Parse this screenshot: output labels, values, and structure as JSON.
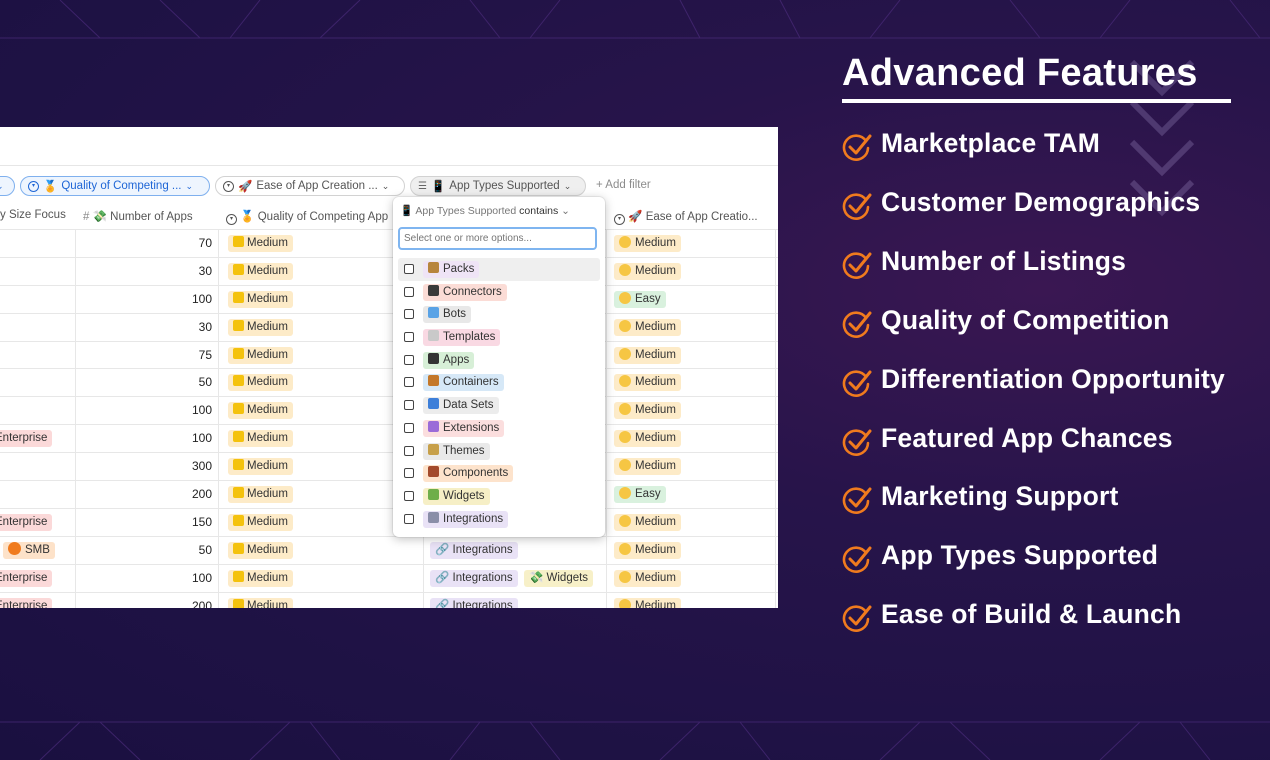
{
  "filter_bar": {
    "chip_quality": "Quality of Competing ...",
    "chip_ease": "Ease of App Creation ...",
    "chip_app_types": "App Types Supported",
    "add_filter": "Add filter"
  },
  "columns": {
    "size_focus": "y Size Focus",
    "number_of_apps": "Number of Apps",
    "quality": "Quality of Competing App",
    "ease": "Ease of App Creatio..."
  },
  "rows": [
    {
      "size": "",
      "apps": "70",
      "quality": "Medium",
      "types": [],
      "ease": "Medium"
    },
    {
      "size": "",
      "apps": "30",
      "quality": "Medium",
      "types": [],
      "ease": "Medium"
    },
    {
      "size": "",
      "apps": "100",
      "quality": "Medium",
      "types": [],
      "ease": "Easy"
    },
    {
      "size": "",
      "apps": "30",
      "quality": "Medium",
      "types": [],
      "ease": "Medium"
    },
    {
      "size": "",
      "apps": "75",
      "quality": "Medium",
      "types": [],
      "ease": "Medium"
    },
    {
      "size": "",
      "apps": "50",
      "quality": "Medium",
      "types": [],
      "ease": "Medium"
    },
    {
      "size": "",
      "apps": "100",
      "quality": "Medium",
      "types": [],
      "ease": "Medium"
    },
    {
      "size": "Enterprise",
      "apps": "100",
      "quality": "Medium",
      "types": [],
      "ease": "Medium"
    },
    {
      "size": "",
      "apps": "300",
      "quality": "Medium",
      "types": [],
      "ease": "Medium"
    },
    {
      "size": "",
      "apps": "200",
      "quality": "Medium",
      "types": [],
      "ease": "Easy"
    },
    {
      "size": "Enterprise",
      "apps": "150",
      "quality": "Medium",
      "types": [],
      "ease": "Medium"
    },
    {
      "size": "SMB",
      "apps": "50",
      "quality": "Medium",
      "types": [
        "Integrations"
      ],
      "ease": "Medium"
    },
    {
      "size": "Enterprise",
      "apps": "100",
      "quality": "Medium",
      "types": [
        "Integrations",
        "Widgets"
      ],
      "ease": "Medium"
    },
    {
      "size": "Enterprise",
      "apps": "200",
      "quality": "Medium",
      "types": [
        "Integrations"
      ],
      "ease": "Medium"
    }
  ],
  "dropdown": {
    "field": "App Types Supported",
    "operator": "contains",
    "placeholder": "Select one or more options...",
    "options": [
      {
        "label": "Packs",
        "bg": "#efe4f6",
        "icon": "#b7853d"
      },
      {
        "label": "Connectors",
        "bg": "#fbdcd6",
        "icon": "#3a3a3a"
      },
      {
        "label": "Bots",
        "bg": "#e8e8e8",
        "icon": "#5aa3e6"
      },
      {
        "label": "Templates",
        "bg": "#f9d9e3",
        "icon": "#c9c9c9"
      },
      {
        "label": "Apps",
        "bg": "#d7efd7",
        "icon": "#333333"
      },
      {
        "label": "Containers",
        "bg": "#d6e8f7",
        "icon": "#c4782a"
      },
      {
        "label": "Data Sets",
        "bg": "#ececec",
        "icon": "#3d7fd9"
      },
      {
        "label": "Extensions",
        "bg": "#fbdede",
        "icon": "#9b6bd8"
      },
      {
        "label": "Themes",
        "bg": "#e9e9e9",
        "icon": "#c7a04a"
      },
      {
        "label": "Components",
        "bg": "#fde3cc",
        "icon": "#a34a2c"
      },
      {
        "label": "Widgets",
        "bg": "#f6efc6",
        "icon": "#6fae4a"
      },
      {
        "label": "Integrations",
        "bg": "#e9e2f6",
        "icon": "#8a8ea8"
      }
    ]
  },
  "right": {
    "title": "Advanced Features",
    "features": [
      "Marketplace TAM",
      "Customer Demographics",
      "Number of Listings",
      "Quality of Competition",
      "Differentiation Opportunity",
      "Featured App Chances",
      "Marketing Support",
      "App Types Supported",
      "Ease of Build & Launch"
    ],
    "check_color": "#f07b1e"
  }
}
